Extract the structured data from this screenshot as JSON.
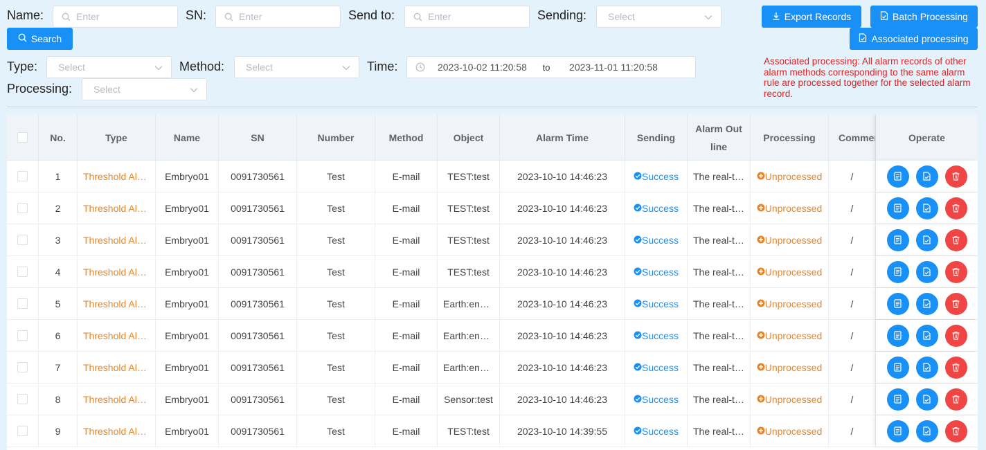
{
  "filters": {
    "name_label": "Name:",
    "name_placeholder": "Enter",
    "sn_label": "SN:",
    "sn_placeholder": "Enter",
    "sendto_label": "Send to:",
    "sendto_placeholder": "Enter",
    "sending_label": "Sending:",
    "sending_placeholder": "Select",
    "type_label": "Type:",
    "type_placeholder": "Select",
    "method_label": "Method:",
    "method_placeholder": "Select",
    "time_label": "Time:",
    "time_start": "2023-10-02 11:20:58",
    "time_to": "to",
    "time_end": "2023-11-01 11:20:58",
    "processing_label": "Processing:",
    "processing_placeholder": "Select"
  },
  "actions": {
    "search_label": "Search",
    "export_label": "Export Records",
    "batch_label": "Batch Processing",
    "associated_label": "Associated processing",
    "note": "Associated processing: All alarm records of other alarm methods corresponding to the same alarm rule are processed together for the selected alarm record."
  },
  "table": {
    "headers": {
      "no": "No.",
      "type": "Type",
      "name": "Name",
      "sn": "SN",
      "number": "Number",
      "method": "Method",
      "object": "Object",
      "alarm_time": "Alarm Time",
      "sending": "Sending",
      "alarm_outline": "Alarm Out line",
      "processing": "Processing",
      "comment": "Comment",
      "operate": "Operate"
    },
    "rows": [
      {
        "no": "1",
        "type": "Threshold Alarm",
        "name": "Embryo01",
        "sn": "0091730561",
        "number": "Test",
        "method": "E-mail",
        "object": "TEST:test",
        "time": "2023-10-10 14:46:23",
        "sending": "Success",
        "outline": "The real-time",
        "processing": "Unprocessed",
        "comment": "/"
      },
      {
        "no": "2",
        "type": "Threshold Alarm",
        "name": "Embryo01",
        "sn": "0091730561",
        "number": "Test",
        "method": "E-mail",
        "object": "TEST:test",
        "time": "2023-10-10 14:46:23",
        "sending": "Success",
        "outline": "The real-time",
        "processing": "Unprocessed",
        "comment": "/"
      },
      {
        "no": "3",
        "type": "Threshold Alarm",
        "name": "Embryo01",
        "sn": "0091730561",
        "number": "Test",
        "method": "E-mail",
        "object": "TEST:test",
        "time": "2023-10-10 14:46:23",
        "sending": "Success",
        "outline": "The real-time",
        "processing": "Unprocessed",
        "comment": "/"
      },
      {
        "no": "4",
        "type": "Threshold Alarm",
        "name": "Embryo01",
        "sn": "0091730561",
        "number": "Test",
        "method": "E-mail",
        "object": "TEST:test",
        "time": "2023-10-10 14:46:23",
        "sending": "Success",
        "outline": "The real-time",
        "processing": "Unprocessed",
        "comment": "/"
      },
      {
        "no": "5",
        "type": "Threshold Alarm",
        "name": "Embryo01",
        "sn": "0091730561",
        "number": "Test",
        "method": "E-mail",
        "object": "Earth:enabled",
        "time": "2023-10-10 14:46:23",
        "sending": "Success",
        "outline": "The real-time",
        "processing": "Unprocessed",
        "comment": "/"
      },
      {
        "no": "6",
        "type": "Threshold Alarm",
        "name": "Embryo01",
        "sn": "0091730561",
        "number": "Test",
        "method": "E-mail",
        "object": "Earth:enabled",
        "time": "2023-10-10 14:46:23",
        "sending": "Success",
        "outline": "The real-time",
        "processing": "Unprocessed",
        "comment": "/"
      },
      {
        "no": "7",
        "type": "Threshold Alarm",
        "name": "Embryo01",
        "sn": "0091730561",
        "number": "Test",
        "method": "E-mail",
        "object": "Earth:enabled",
        "time": "2023-10-10 14:46:23",
        "sending": "Success",
        "outline": "The real-time",
        "processing": "Unprocessed",
        "comment": "/"
      },
      {
        "no": "8",
        "type": "Threshold Alarm",
        "name": "Embryo01",
        "sn": "0091730561",
        "number": "Test",
        "method": "E-mail",
        "object": "Sensor:test",
        "time": "2023-10-10 14:46:23",
        "sending": "Success",
        "outline": "The real-time",
        "processing": "Unprocessed",
        "comment": "/"
      },
      {
        "no": "9",
        "type": "Threshold Alarm",
        "name": "Embryo01",
        "sn": "0091730561",
        "number": "Test",
        "method": "E-mail",
        "object": "TEST:test",
        "time": "2023-10-10 14:39:55",
        "sending": "Success",
        "outline": "The real-time",
        "processing": "Unprocessed",
        "comment": "/"
      }
    ]
  },
  "colors": {
    "primary": "#1890f5",
    "danger": "#f04545",
    "warning": "#e6862a",
    "background": "#e4f3fb"
  }
}
